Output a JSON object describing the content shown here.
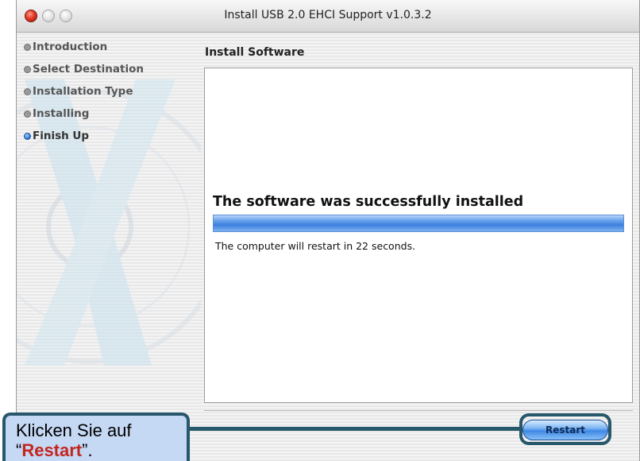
{
  "window": {
    "title": "Install USB 2.0 EHCI Support v1.0.3.2"
  },
  "sidebar": {
    "steps": [
      {
        "label": "Introduction",
        "active": false
      },
      {
        "label": "Select Destination",
        "active": false
      },
      {
        "label": "Installation Type",
        "active": false
      },
      {
        "label": "Installing",
        "active": false
      },
      {
        "label": "Finish Up",
        "active": true
      }
    ]
  },
  "main": {
    "section_title": "Install Software",
    "success_heading": "The software was successfully installed",
    "progress_fraction": 1.0,
    "status_text": "The computer will restart in 22 seconds."
  },
  "buttons": {
    "restart_label": "Restart"
  },
  "callout": {
    "line1": "Klicken Sie auf",
    "quote_open": "“",
    "highlight": "Restart",
    "quote_close": "”."
  },
  "colors": {
    "callout_border": "#27576b",
    "callout_fill": "#c5d8f4",
    "callout_highlight": "#c4261f",
    "accent_blue": "#3b7fdd"
  }
}
